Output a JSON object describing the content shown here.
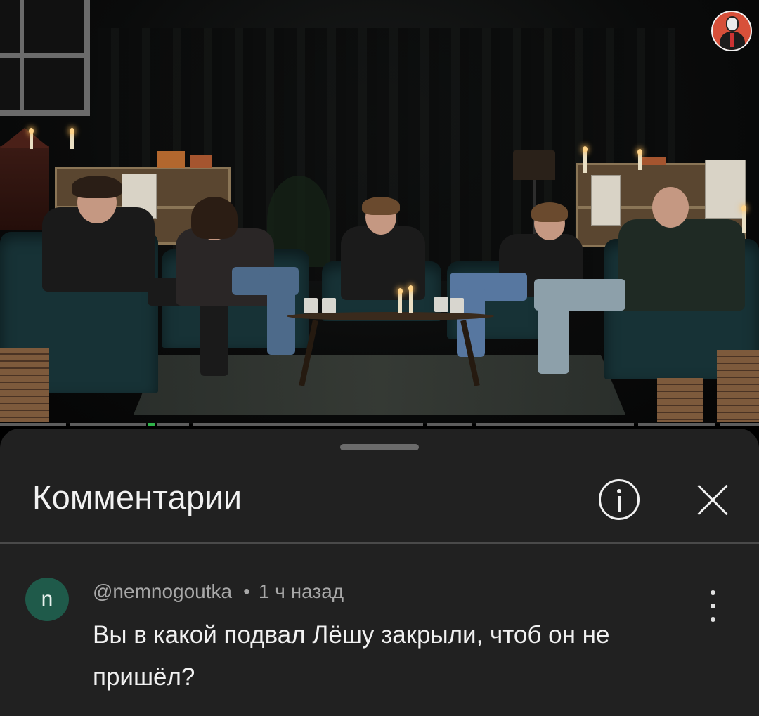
{
  "video": {
    "progress_fraction": 0.2,
    "accent_color": "#2fb34a"
  },
  "comments_sheet": {
    "title": "Комментарии",
    "info_icon": "info-circle-icon",
    "close_icon": "close-icon"
  },
  "comments": [
    {
      "avatar_letter": "n",
      "avatar_color": "#1f5a4a",
      "author": "@nemnogoutka",
      "separator": "•",
      "time": "1 ч назад",
      "text": "Вы в какой подвал Лёшу закрыли, чтоб он не пришёл?"
    }
  ]
}
